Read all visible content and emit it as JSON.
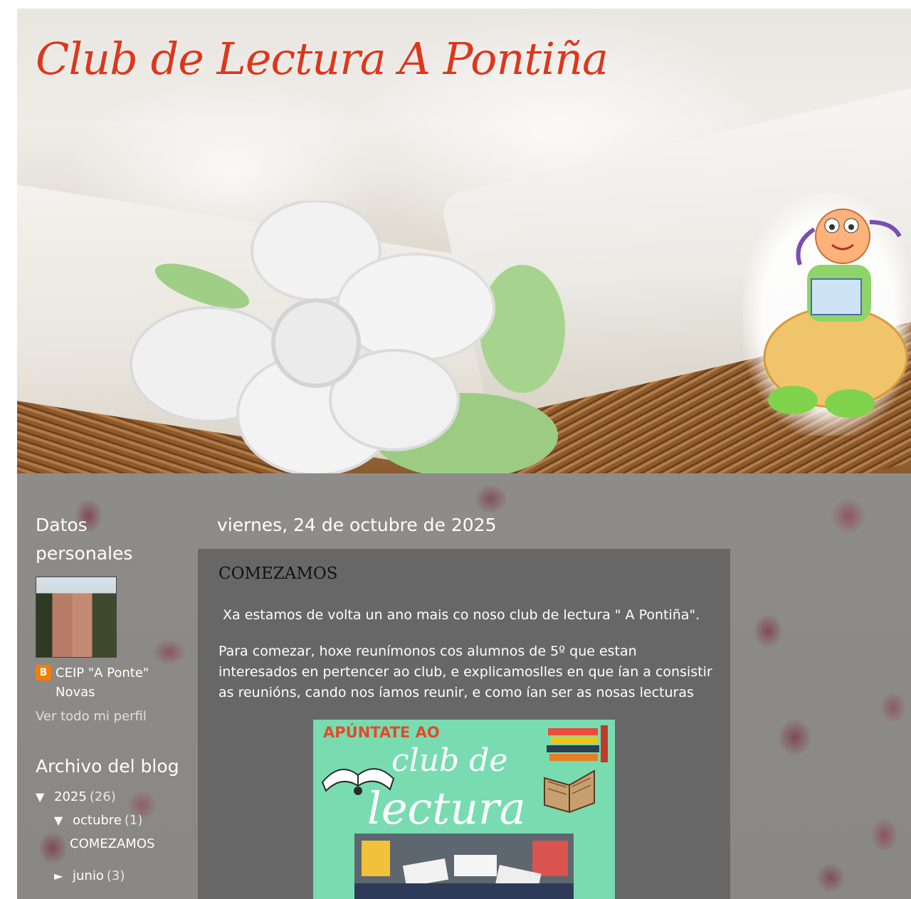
{
  "header": {
    "title": "Club de Lectura A Pontiña"
  },
  "sidebar": {
    "profile": {
      "heading": "Datos personales",
      "name": "CEIP \"A Ponte\" Novas",
      "view_profile": "Ver todo mi perfil"
    },
    "archive": {
      "heading": "Archivo del blog",
      "items": [
        {
          "arrow": "▼",
          "label": "2025",
          "count": "(26)"
        },
        {
          "arrow": "▼",
          "label": "octubre",
          "count": "(1)"
        },
        {
          "label": "COMEZAMOS"
        },
        {
          "arrow": "►",
          "label": "junio",
          "count": "(3)"
        }
      ]
    }
  },
  "main": {
    "date": "viernes, 24 de octubre de 2025",
    "post": {
      "title": "COMEZAMOS",
      "p1": "Xa estamos de volta un ano mais co noso club de lectura \" A Pontiña\".",
      "p2": "Para comezar, hoxe reunímonos cos alumnos de 5º que estan interesados en pertencer ao club, e explicamoslles en que ían a consistir as reunións, cando nos íamos reunir, e como ían ser as nosas lecturas",
      "poster": {
        "top_text": "APÚNTATE AO",
        "club_text": "club de",
        "lectura_text": "lectura"
      }
    }
  },
  "icons": {
    "blogger": "blogger-icon",
    "blogger_color": "#f57d00"
  },
  "colors": {
    "title": "#e0361c",
    "post_bg": "#676767",
    "poster_bg": "#78dcb0"
  }
}
